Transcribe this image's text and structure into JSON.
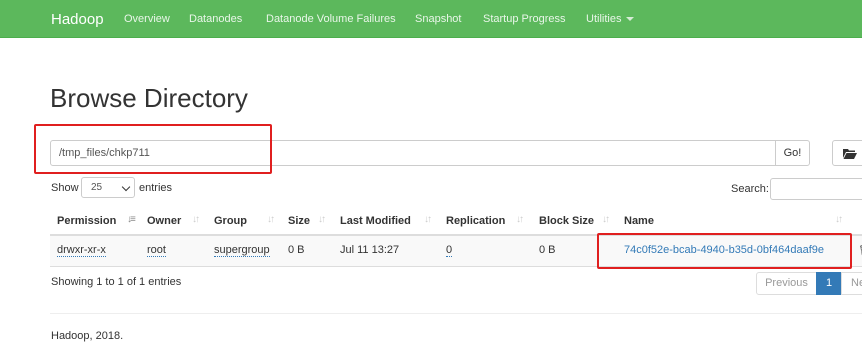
{
  "navbar": {
    "brand": "Hadoop",
    "items": [
      "Overview",
      "Datanodes",
      "Datanode Volume Failures",
      "Snapshot",
      "Startup Progress",
      "Utilities"
    ],
    "bg_color": "#5cb85c"
  },
  "page": {
    "title": "Browse Directory"
  },
  "path_form": {
    "value": "/tmp_files/chkp711",
    "go_label": "Go!",
    "folder_icon": "folder-open-icon"
  },
  "table_controls": {
    "show_label": "Show",
    "entries_value": "25",
    "entries_label": "entries",
    "search_label": "Search:",
    "search_value": ""
  },
  "table": {
    "columns": [
      "Permission",
      "Owner",
      "Group",
      "Size",
      "Last Modified",
      "Replication",
      "Block Size",
      "Name"
    ],
    "sorted_column": "Permission",
    "rows": [
      {
        "permission": "drwxr-xr-x",
        "owner": "root",
        "group": "supergroup",
        "size": "0 B",
        "last_modified": "Jul 11 13:27",
        "replication": "0",
        "block_size": "0 B",
        "name": "74c0f52e-bcab-4940-b35d-0bf464daaf9e"
      }
    ]
  },
  "pagination": {
    "info": "Showing 1 to 1 of 1 entries",
    "previous": "Previous",
    "current": "1",
    "next": "Ne"
  },
  "footer": {
    "text": "Hadoop, 2018."
  },
  "colors": {
    "link": "#337ab7",
    "highlight_box": "#e01f1f"
  }
}
